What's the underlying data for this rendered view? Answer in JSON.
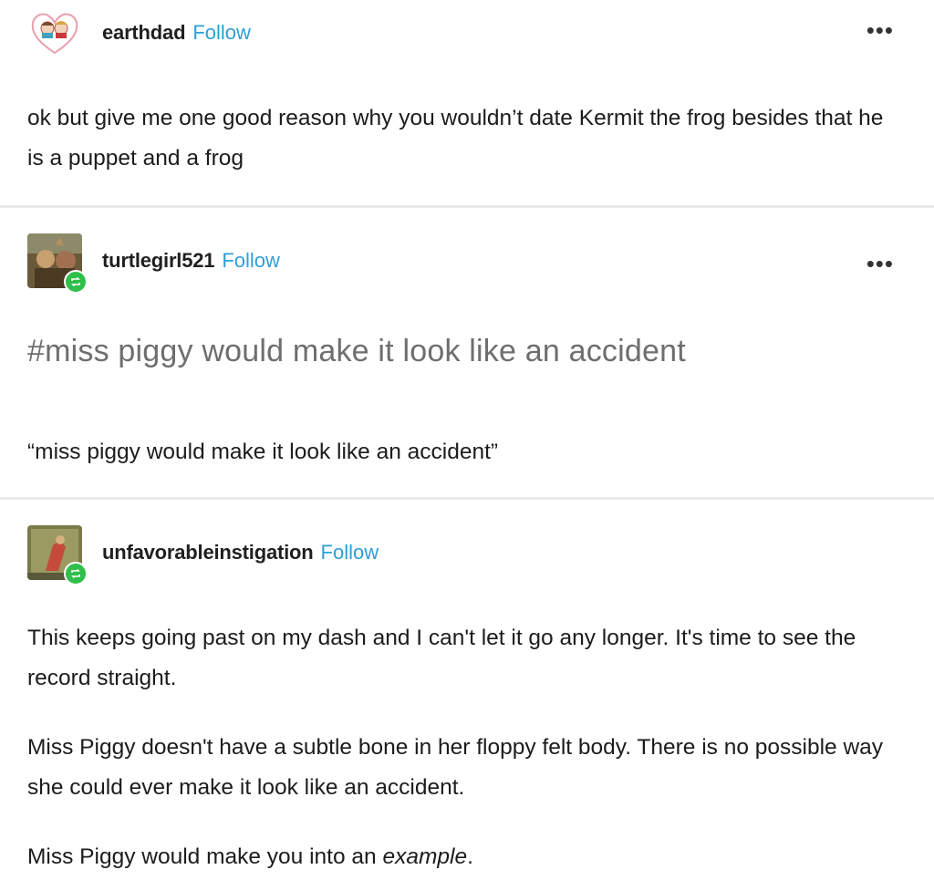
{
  "posts": [
    {
      "username": "earthdad",
      "follow_label": "Follow",
      "more_label": "•••",
      "avatar_icon": "heart-faces-avatar-icon",
      "body": "ok but give me one good reason why you wouldn’t date Kermit the frog besides that he is a puppet and a frog"
    },
    {
      "username": "turtlegirl521",
      "follow_label": "Follow",
      "more_label": "•••",
      "avatar_icon": "photo-avatar-icon",
      "reblog_icon": "reblog-icon",
      "tag": "#miss piggy would make it look like an accident",
      "body": "“miss piggy would make it look like an accident”"
    },
    {
      "username": "unfavorableinstigation",
      "follow_label": "Follow",
      "avatar_icon": "photo-avatar-icon",
      "reblog_icon": "reblog-icon",
      "paragraph1": "This keeps going past on my dash and I can't let it go any longer. It's time to see the record straight.",
      "paragraph2": "Miss Piggy doesn't have a subtle bone in her floppy felt body. There is no possible way she could ever make it look like an accident.",
      "paragraph3_prefix": "Miss Piggy would make you into an ",
      "paragraph3_emphasis": "example",
      "paragraph3_suffix": "."
    }
  ],
  "colors": {
    "follow": "#2d9fd8",
    "reblog_badge": "#2fbf4a",
    "divider": "#e9e9e9",
    "tag_text": "#6e6e6e"
  }
}
